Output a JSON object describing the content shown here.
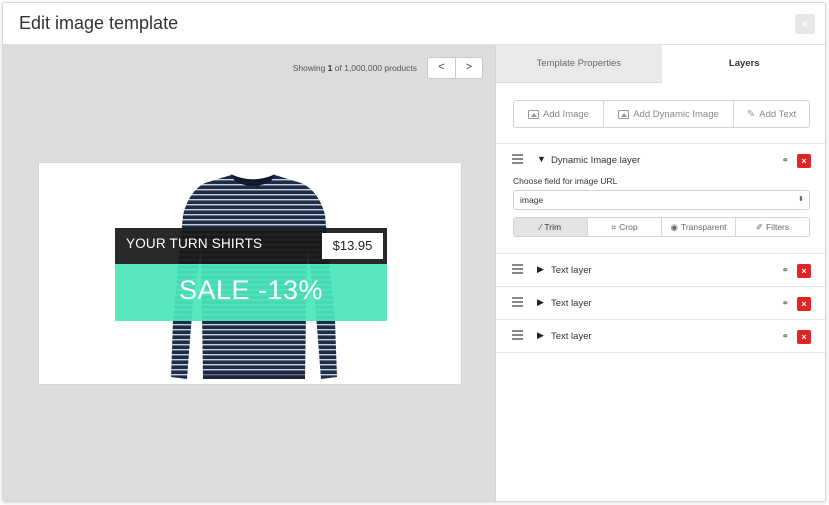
{
  "dialog": {
    "title": "Edit image template",
    "close_label": "×"
  },
  "pager": {
    "prefix": "Showing ",
    "current": "1",
    "suffix": " of 1,000,000 products",
    "prev_label": "<",
    "next_label": ">"
  },
  "preview": {
    "brand_text": "YOUR TURN SHIRTS",
    "price_text": "$13.95",
    "sale_text": "SALE -13%",
    "colors": {
      "dark_band": "#191919",
      "green_band": "#4ae6bb",
      "shirt_navy": "#1f2c45",
      "shirt_stripe": "#c5d0de"
    }
  },
  "panel": {
    "tabs": [
      {
        "label": "Template Properties",
        "active": false
      },
      {
        "label": "Layers",
        "active": true
      }
    ],
    "add_buttons": [
      {
        "label": "Add Image",
        "icon": "image-icon"
      },
      {
        "label": "Add Dynamic Image",
        "icon": "image-icon"
      },
      {
        "label": "Add Text",
        "icon": "pencil-icon"
      }
    ],
    "layers": [
      {
        "name": "Dynamic Image layer",
        "expanded": true
      },
      {
        "name": "Text layer",
        "expanded": false
      },
      {
        "name": "Text layer",
        "expanded": false
      },
      {
        "name": "Text layer",
        "expanded": false
      }
    ],
    "field_label": "Choose field for image URL",
    "field_value": "image",
    "tools": [
      {
        "label": "Trim",
        "icon": "wand-icon",
        "active": true
      },
      {
        "label": "Crop",
        "icon": "crop-icon",
        "active": false
      },
      {
        "label": "Transparent",
        "icon": "eye-icon",
        "active": false
      },
      {
        "label": "Filters",
        "icon": "brush-icon",
        "active": false
      }
    ],
    "delete_label": "×",
    "accent_delete": "#e02424"
  }
}
